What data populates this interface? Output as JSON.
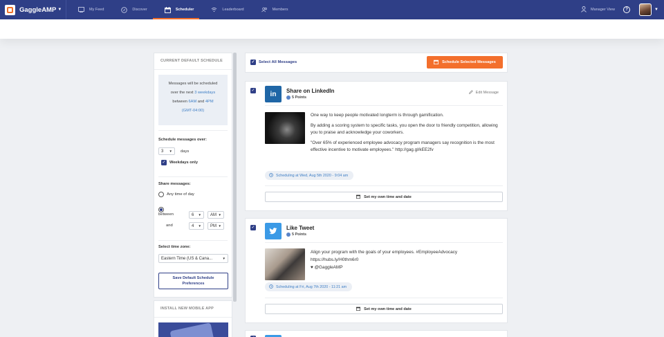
{
  "nav": {
    "brand": "GaggleAMP",
    "items": [
      {
        "label": "My Feed",
        "icon": "feed-icon"
      },
      {
        "label": "Discover",
        "icon": "compass-icon"
      },
      {
        "label": "Scheduler",
        "icon": "calendar-icon",
        "active": true
      },
      {
        "label": "Leaderboard",
        "icon": "signal-icon"
      },
      {
        "label": "Members",
        "icon": "users-icon"
      }
    ],
    "manager_view": "Manager View",
    "help": "?"
  },
  "sidebar": {
    "schedule_title": "CURRENT DEFAULT SCHEDULE",
    "info": {
      "line1": "Messages will be scheduled",
      "over_prefix": "over the next ",
      "over_days": "3 weekdays",
      "between_prefix": "between ",
      "start": "6AM",
      "and": " and ",
      "end": "4PM",
      "timezone": "(GMT-04:00)"
    },
    "schedule_over_label": "Schedule messages over:",
    "days_value": "3",
    "days_label": "days",
    "weekdays_label": "Weekdays only",
    "share_label": "Share messages:",
    "any_time_label": "Any time of day",
    "between_label": "between",
    "and_label": "and",
    "start_hour": "6",
    "start_ampm": "AM",
    "end_hour": "4",
    "end_ampm": "PM",
    "timezone_label": "Select time zone:",
    "timezone_value": "Eastern Time (US & Cana...",
    "save_button_line1": "Save Default Schedule",
    "save_button_line2": "Preferences",
    "mobile_title": "INSTALL NEW MOBILE APP"
  },
  "main": {
    "select_all": "Select All Messages",
    "schedule_selected": "Schedule Selected Messages",
    "cards": [
      {
        "title": "Share on LinkedIn",
        "points": "5 Points",
        "network": "linkedin",
        "network_color": "#1f66a6",
        "edit": "Edit Message",
        "paragraphs": [
          "One way to keep people motivated longterm is through gamification.",
          "By adding a scoring system to specific tasks, you open the door to friendly competition, allowing you to praise and acknowledge your coworkers.",
          "\"Over 65% of experienced employee advocacy program managers say recognition is the most effective incentive to motivate employees.\" http://gag.gl/kEE2fv"
        ],
        "scheduling": "Scheduling at Wed, Aug 5th 2020 - 9:04 am",
        "own_time": "Set my own time and date"
      },
      {
        "title": "Like Tweet",
        "points": "5 Points",
        "network": "twitter",
        "network_color": "#3b9ae6",
        "paragraphs": [
          "Align your program with the goals of your employees. #EmployeeAdvocacy",
          "https://hubs.ly/H0thm6r0",
          "♥ @GaggleAMP"
        ],
        "scheduling": "Scheduling at Fri, Aug 7th 2020 - 11:21 am",
        "own_time": "Set my own time and date"
      }
    ]
  },
  "colors": {
    "nav_bg": "#2f3f87",
    "accent": "#f36f2c",
    "link": "#3e7ec5"
  }
}
